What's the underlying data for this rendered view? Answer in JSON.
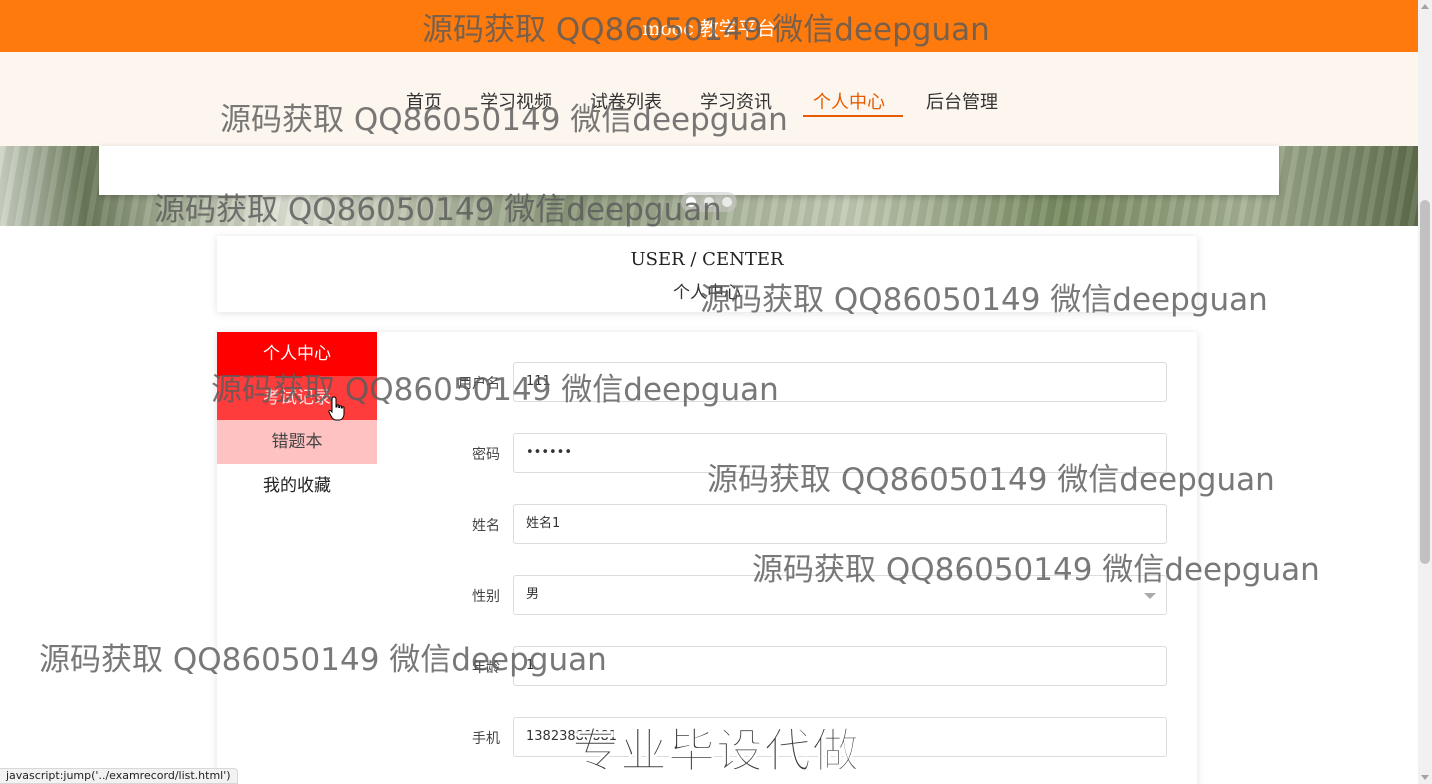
{
  "site": {
    "title": "mooc 教学平台"
  },
  "nav": {
    "items": [
      {
        "label": "首页"
      },
      {
        "label": "学习视频"
      },
      {
        "label": "试卷列表"
      },
      {
        "label": "学习资讯"
      },
      {
        "label": "个人中心",
        "active": true
      },
      {
        "label": "后台管理"
      }
    ]
  },
  "user_center": {
    "title_en": "USER / CENTER",
    "title_cn": "个人中心"
  },
  "side_menu": {
    "items": [
      {
        "label": "个人中心"
      },
      {
        "label": "考试记录"
      },
      {
        "label": "错题本"
      },
      {
        "label": "我的收藏"
      }
    ]
  },
  "form": {
    "username": {
      "label": "用户名",
      "value": "111"
    },
    "password": {
      "label": "密码",
      "value": "••••••"
    },
    "name": {
      "label": "姓名",
      "value": "姓名1"
    },
    "gender": {
      "label": "性别",
      "value": "男"
    },
    "age": {
      "label": "年龄",
      "value": "1"
    },
    "phone": {
      "label": "手机",
      "value": "13823888881"
    }
  },
  "watermark": {
    "text": "源码获取 QQ86050149 微信deepguan",
    "banner_text": "专业毕设代做"
  },
  "status_bar": {
    "url": "javascript:jump('../examrecord/list.html')"
  },
  "colors": {
    "header": "#ff7a0c",
    "nav_active": "#e65c00",
    "side_active": "#ff0000",
    "side_hover": "#ff3c3c",
    "side_light": "#ffc2c2"
  },
  "icons": [
    "hand-pointer-icon",
    "select-arrow-icon",
    "scroll-up-icon",
    "scroll-down-icon"
  ]
}
